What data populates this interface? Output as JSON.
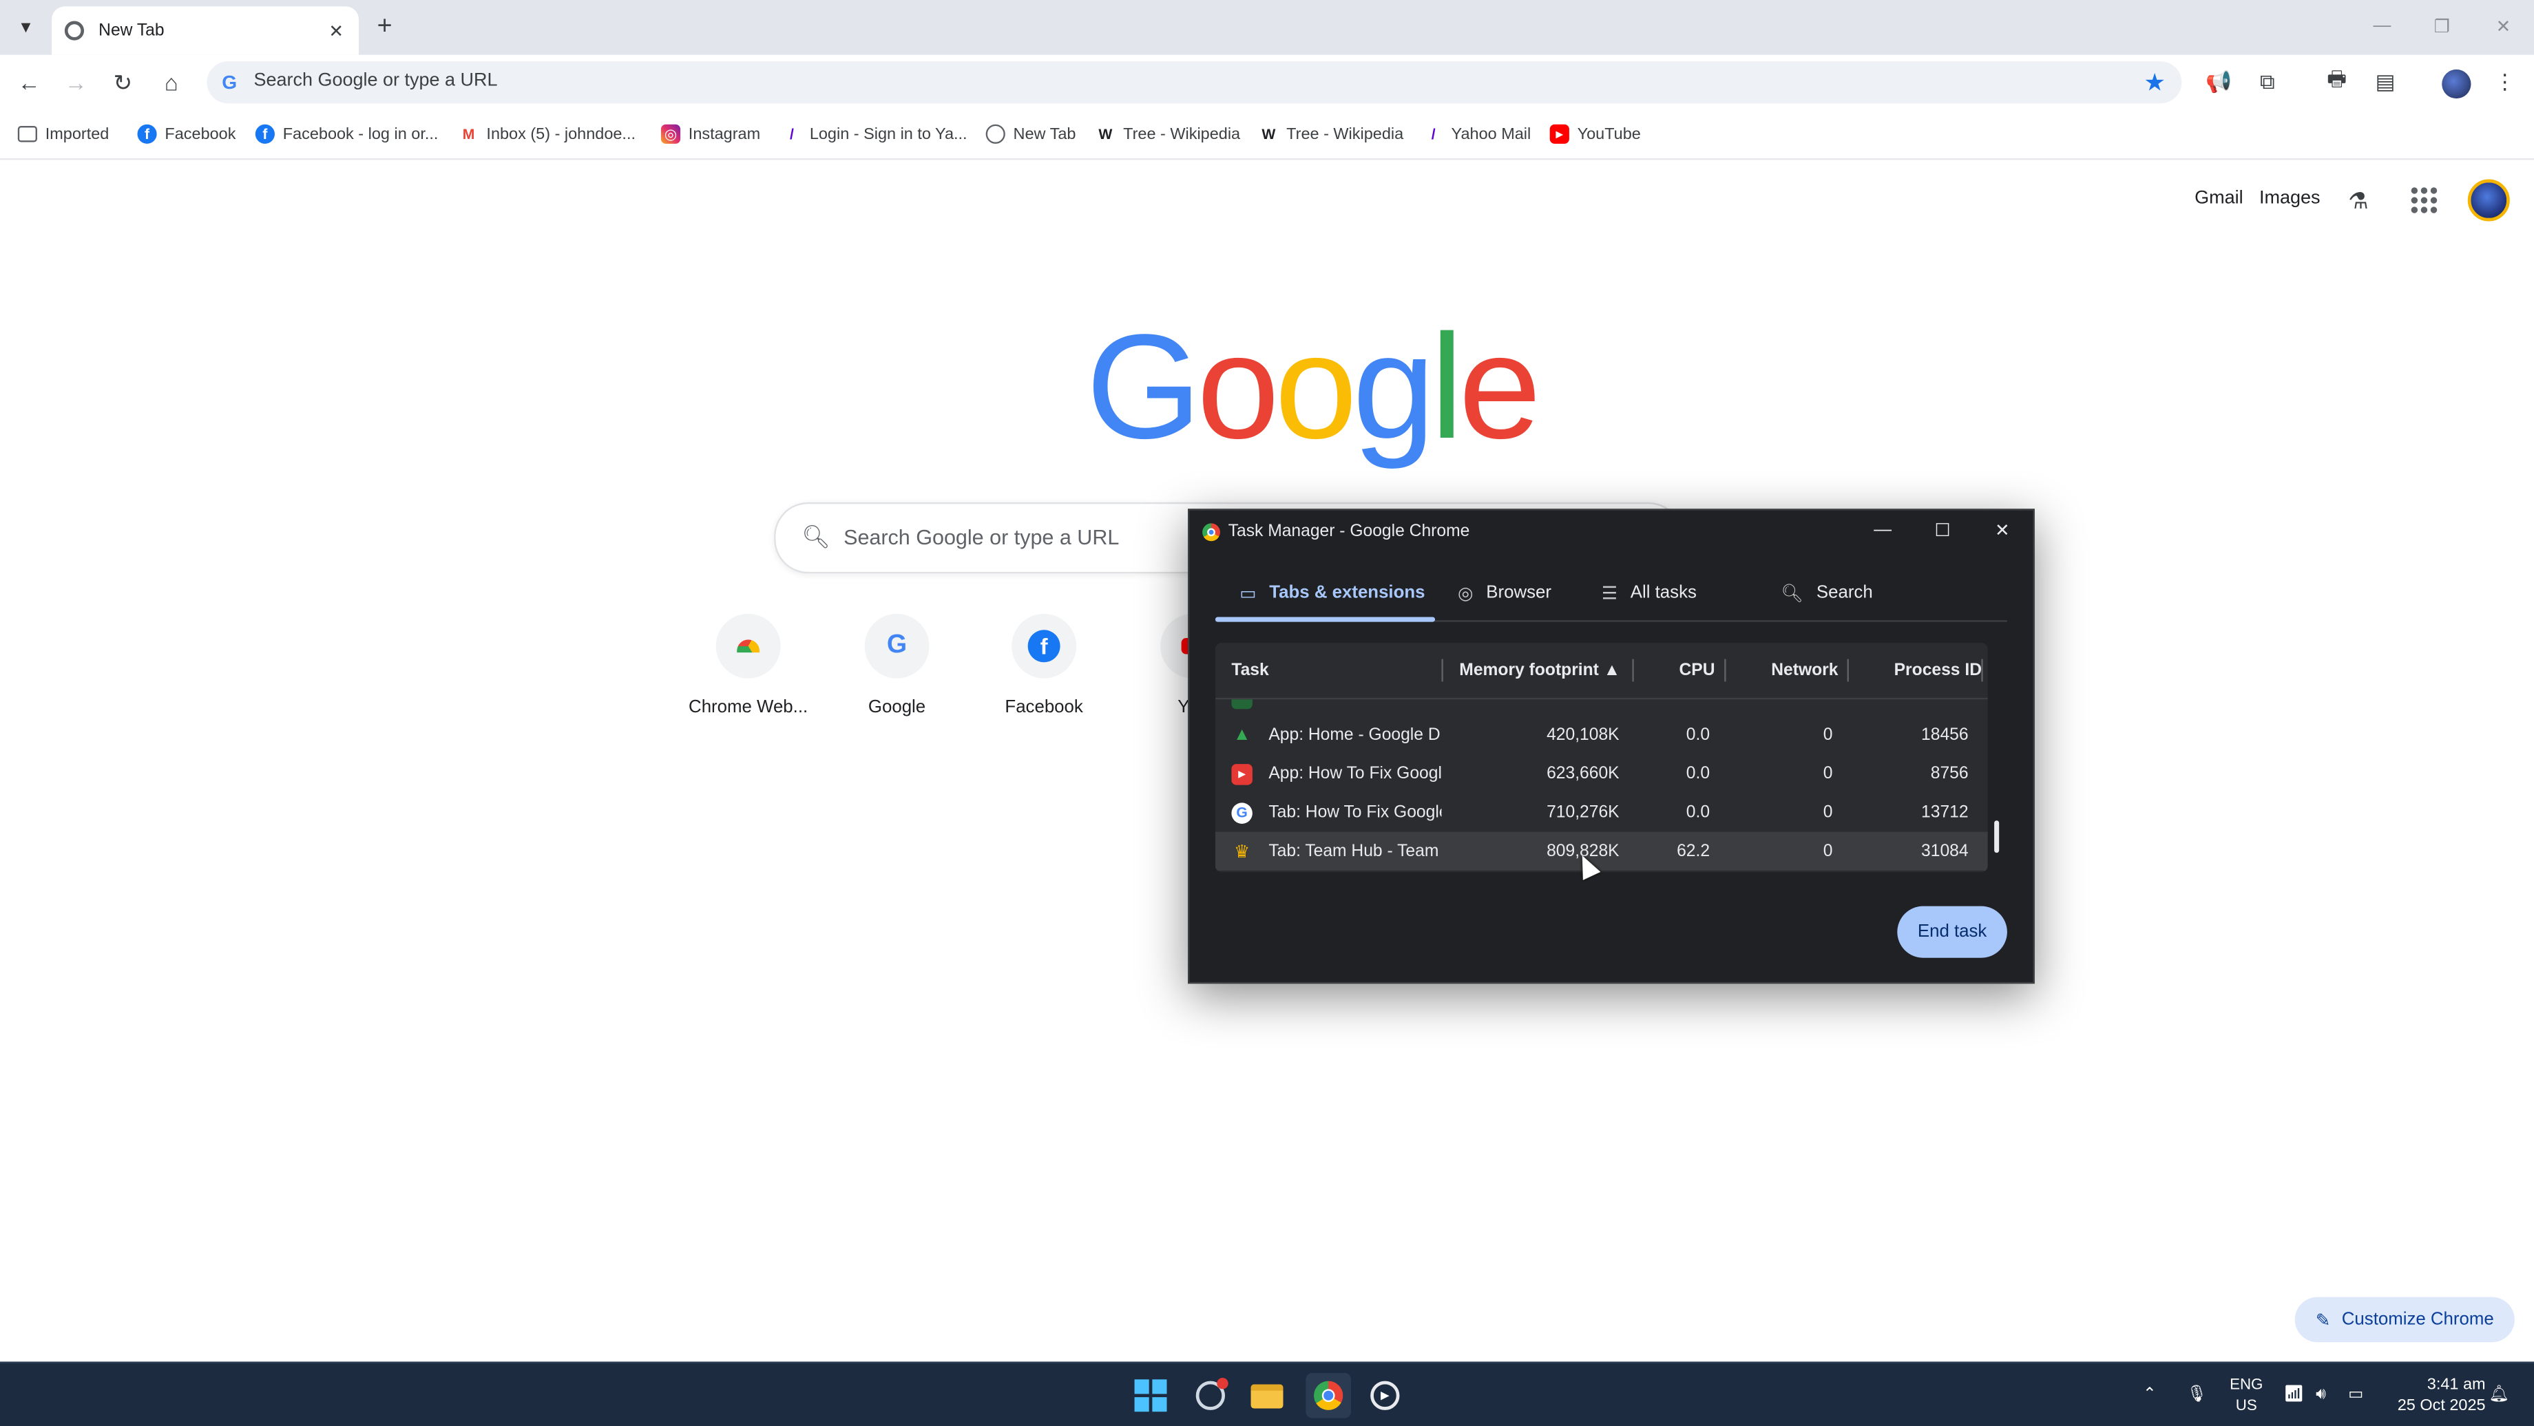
{
  "browser": {
    "tab_title": "New Tab",
    "omnibox_placeholder": "Search Google or type a URL",
    "bookmarks": [
      {
        "label": "Imported",
        "icon": "folder-icon"
      },
      {
        "label": "Facebook",
        "icon": "facebook-icon"
      },
      {
        "label": "Facebook - log in or...",
        "icon": "facebook-icon"
      },
      {
        "label": "Inbox (5) - johndoe...",
        "icon": "gmail-icon"
      },
      {
        "label": "Instagram",
        "icon": "instagram-icon"
      },
      {
        "label": "Login - Sign in to Ya...",
        "icon": "yahoo-icon"
      },
      {
        "label": "New Tab",
        "icon": "globe-icon"
      },
      {
        "label": "Tree - Wikipedia",
        "icon": "wikipedia-icon"
      },
      {
        "label": "Tree - Wikipedia",
        "icon": "wikipedia-icon"
      },
      {
        "label": "Yahoo Mail",
        "icon": "yahoo-icon"
      },
      {
        "label": "YouTube",
        "icon": "youtube-icon"
      }
    ]
  },
  "ntp": {
    "gmail": "Gmail",
    "images": "Images",
    "search_placeholder": "Search Google or type a URL",
    "shortcuts": [
      {
        "label": "Chrome Web..."
      },
      {
        "label": "Google"
      },
      {
        "label": "Facebook"
      },
      {
        "label": "You"
      }
    ],
    "customize": "Customize Chrome"
  },
  "task_manager": {
    "title": "Task Manager - Google Chrome",
    "tabs": [
      {
        "label": "Tabs & extensions",
        "active": true
      },
      {
        "label": "Browser",
        "active": false
      },
      {
        "label": "All tasks",
        "active": false
      }
    ],
    "search_label": "Search",
    "columns": [
      "Task",
      "Memory footprint ▲",
      "CPU",
      "Network",
      "Process ID"
    ],
    "rows": [
      {
        "task": "App: Home - Google D",
        "memory": "420,108K",
        "cpu": "0.0",
        "network": "0",
        "pid": "18456",
        "icon": "google-drive-icon",
        "color": "#1e8e3e"
      },
      {
        "task": "App: How To Fix Googl",
        "memory": "623,660K",
        "cpu": "0.0",
        "network": "0",
        "pid": "8756",
        "icon": "youtube-icon",
        "color": "#e53935"
      },
      {
        "task": "Tab: How To Fix Google",
        "memory": "710,276K",
        "cpu": "0.0",
        "network": "0",
        "pid": "13712",
        "icon": "google-icon",
        "color": "#ffffff"
      },
      {
        "task": "Tab: Team Hub - Team I",
        "memory": "809,828K",
        "cpu": "62.2",
        "network": "0",
        "pid": "31084",
        "icon": "crown-icon",
        "color": "#f4b400"
      }
    ],
    "end_task": "End task"
  },
  "taskbar": {
    "lang_top": "ENG",
    "lang_bottom": "US",
    "time": "3:41 am",
    "date": "25 Oct 2025"
  }
}
